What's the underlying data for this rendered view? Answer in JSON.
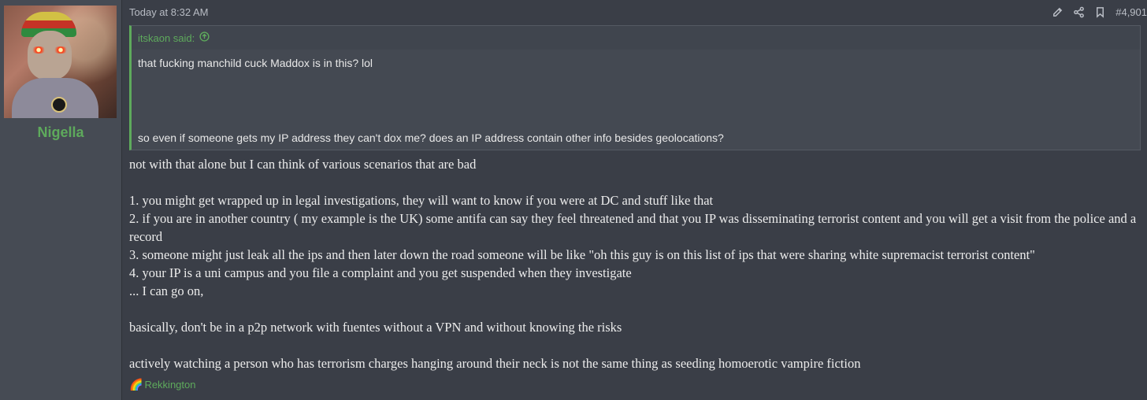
{
  "user": {
    "name": "Nigella"
  },
  "post": {
    "time": "Today at 8:32 AM",
    "number": "#4,901",
    "action_icons": [
      "edit-icon",
      "share-icon",
      "bookmark-icon"
    ]
  },
  "quote": {
    "author": "itskaon said:",
    "lines": [
      "that fucking manchild cuck Maddox is in this? lol",
      "so even if someone gets my IP address they can't dox me? does an IP address contain other info besides geolocations?"
    ]
  },
  "body": {
    "lines": [
      "not with that alone but I can think of various scenarios that are bad",
      "1. you might get wrapped up in legal investigations, they will want to know if you were at DC and stuff like that",
      "2. if you are in another country ( my example is the UK) some antifa can say they feel threatened and that you IP was disseminating terrorist content and you will get a visit from the police and a record",
      "3. someone might just leak all the ips and then later down the road someone will be like \"oh this guy is on this list of ips that were sharing white supremacist terrorist content\"",
      "4. your IP is a uni campus and you file a complaint and you get suspended when they investigate",
      "... I can go on,",
      "basically, don't be in a p2p network with fuentes without a VPN and without knowing the risks",
      "actively watching a person who has terrorism charges hanging around their neck is not the same thing as seeding homoerotic vampire fiction"
    ]
  },
  "reaction": {
    "emoji": "🌈",
    "user": "Rekkington"
  },
  "colors": {
    "accent": "#5eaa5c",
    "background": "#3a3e47",
    "sidebar": "#464b54"
  }
}
